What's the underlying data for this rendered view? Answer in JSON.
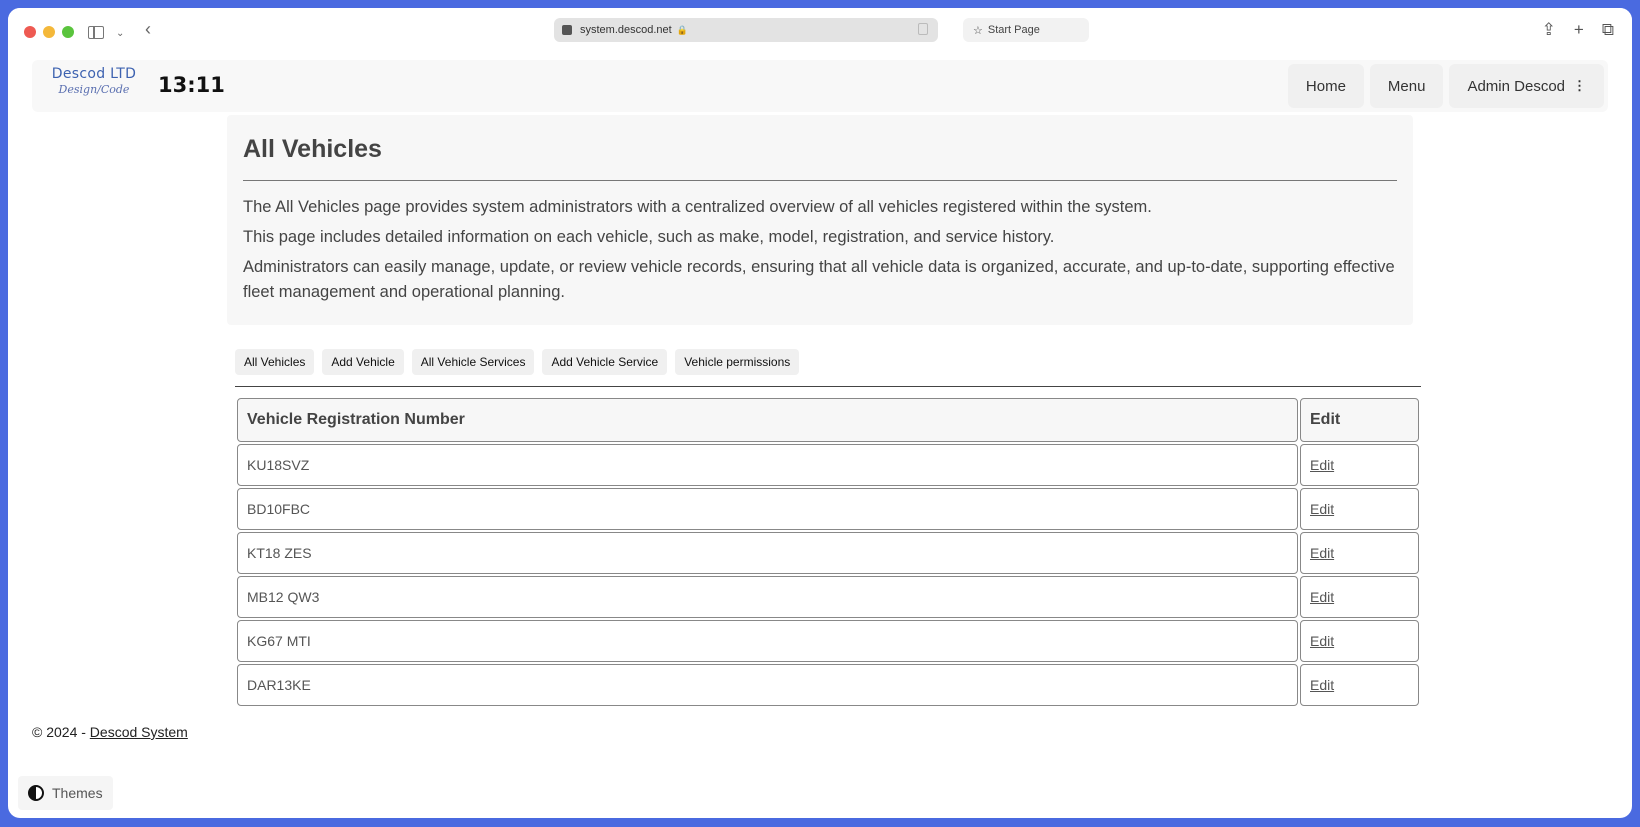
{
  "browser": {
    "address": "system.descod.net",
    "start_page": "Start Page"
  },
  "navbar": {
    "logo_title": "Descod LTD",
    "logo_subtitle": "Design/Code",
    "clock": "13:11",
    "items": [
      {
        "label": "Home"
      },
      {
        "label": "Menu"
      },
      {
        "label": "Admin Descod"
      }
    ]
  },
  "intro": {
    "title": "All Vehicles",
    "paragraphs": [
      "The All Vehicles page provides system administrators with a centralized overview of all vehicles registered within the system.",
      "This page includes detailed information on each vehicle, such as make, model, registration, and service history.",
      "Administrators can easily manage, update, or review vehicle records, ensuring that all vehicle data is organized, accurate, and up-to-date, supporting effective fleet management and operational planning."
    ]
  },
  "subnav": [
    {
      "label": "All Vehicles"
    },
    {
      "label": "Add Vehicle"
    },
    {
      "label": "All Vehicle Services"
    },
    {
      "label": "Add Vehicle Service"
    },
    {
      "label": "Vehicle permissions"
    }
  ],
  "table": {
    "headers": [
      "Vehicle Registration Number",
      "Edit"
    ],
    "rows": [
      {
        "registration": "KU18SVZ",
        "edit": "Edit"
      },
      {
        "registration": "BD10FBC",
        "edit": "Edit"
      },
      {
        "registration": "KT18 ZES",
        "edit": "Edit"
      },
      {
        "registration": "MB12 QW3",
        "edit": "Edit"
      },
      {
        "registration": "KG67 MTI",
        "edit": "Edit"
      },
      {
        "registration": "DAR13KE",
        "edit": "Edit"
      }
    ]
  },
  "footer": {
    "copyright": "© 2024 - ",
    "link": "Descod System"
  },
  "themes_label": "Themes"
}
